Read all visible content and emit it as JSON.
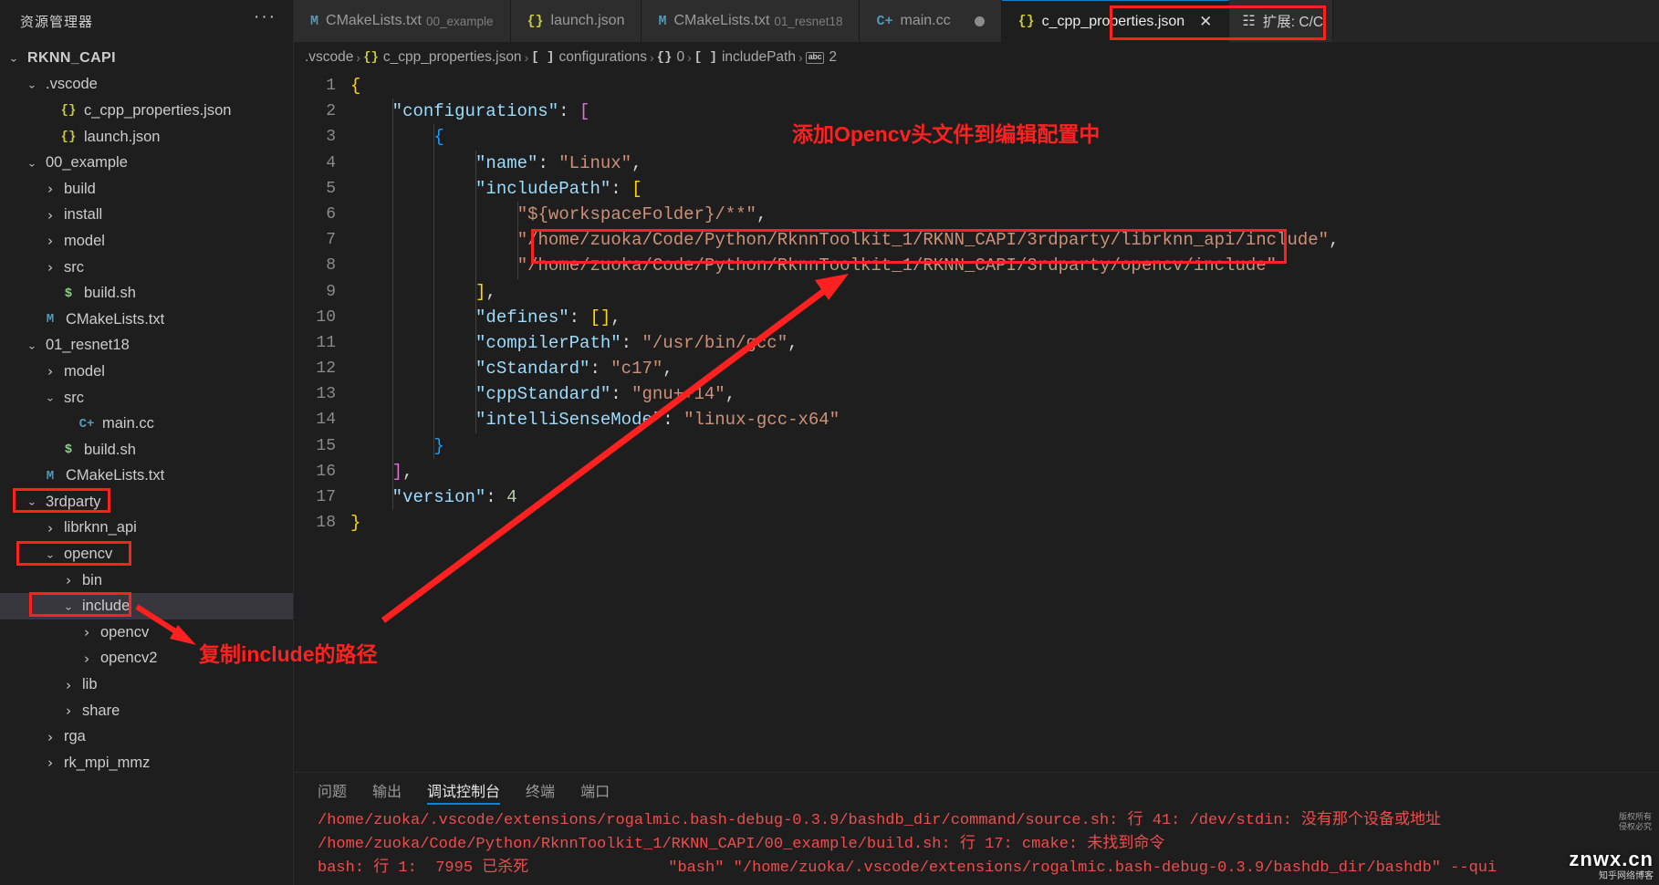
{
  "sidebar": {
    "title": "资源管理器",
    "more_icon": "ellipsis-icon",
    "root": "RKNN_CAPI",
    "items": [
      {
        "label": ".vscode",
        "indent": 1,
        "chev": "down",
        "icon": ""
      },
      {
        "label": "c_cpp_properties.json",
        "indent": 2,
        "chev": "",
        "icon": "{}"
      },
      {
        "label": "launch.json",
        "indent": 2,
        "chev": "",
        "icon": "{}"
      },
      {
        "label": "00_example",
        "indent": 1,
        "chev": "down",
        "icon": ""
      },
      {
        "label": "build",
        "indent": 2,
        "chev": "right",
        "icon": ""
      },
      {
        "label": "install",
        "indent": 2,
        "chev": "right",
        "icon": ""
      },
      {
        "label": "model",
        "indent": 2,
        "chev": "right",
        "icon": ""
      },
      {
        "label": "src",
        "indent": 2,
        "chev": "right",
        "icon": ""
      },
      {
        "label": "build.sh",
        "indent": 2,
        "chev": "",
        "icon": "$"
      },
      {
        "label": "CMakeLists.txt",
        "indent": 1,
        "chev": "",
        "icon": "M"
      },
      {
        "label": "01_resnet18",
        "indent": 1,
        "chev": "down",
        "icon": ""
      },
      {
        "label": "model",
        "indent": 2,
        "chev": "right",
        "icon": ""
      },
      {
        "label": "src",
        "indent": 2,
        "chev": "down",
        "icon": ""
      },
      {
        "label": "main.cc",
        "indent": 3,
        "chev": "",
        "icon": "C+"
      },
      {
        "label": "build.sh",
        "indent": 2,
        "chev": "",
        "icon": "$"
      },
      {
        "label": "CMakeLists.txt",
        "indent": 1,
        "chev": "",
        "icon": "M"
      },
      {
        "label": "3rdparty",
        "indent": 1,
        "chev": "down",
        "icon": ""
      },
      {
        "label": "librknn_api",
        "indent": 2,
        "chev": "right",
        "icon": ""
      },
      {
        "label": "opencv",
        "indent": 2,
        "chev": "down",
        "icon": ""
      },
      {
        "label": "bin",
        "indent": 3,
        "chev": "right",
        "icon": ""
      },
      {
        "label": "include",
        "indent": 3,
        "chev": "down",
        "icon": "",
        "selected": true
      },
      {
        "label": "opencv",
        "indent": 4,
        "chev": "right",
        "icon": ""
      },
      {
        "label": "opencv2",
        "indent": 4,
        "chev": "right",
        "icon": ""
      },
      {
        "label": "lib",
        "indent": 3,
        "chev": "right",
        "icon": ""
      },
      {
        "label": "share",
        "indent": 3,
        "chev": "right",
        "icon": ""
      },
      {
        "label": "rga",
        "indent": 2,
        "chev": "right",
        "icon": ""
      },
      {
        "label": "rk_mpi_mmz",
        "indent": 2,
        "chev": "right",
        "icon": ""
      }
    ]
  },
  "tabs": [
    {
      "icon": "M",
      "icon_kind": "m",
      "label": "CMakeLists.txt",
      "sub": "00_example",
      "active": false,
      "dirty": false,
      "close": false
    },
    {
      "icon": "{}",
      "icon_kind": "j",
      "label": "launch.json",
      "sub": "",
      "active": false,
      "dirty": false,
      "close": false
    },
    {
      "icon": "M",
      "icon_kind": "m",
      "label": "CMakeLists.txt",
      "sub": "01_resnet18",
      "active": false,
      "dirty": false,
      "close": false
    },
    {
      "icon": "C+",
      "icon_kind": "c",
      "label": "main.cc",
      "sub": "",
      "active": false,
      "dirty": true,
      "close": false
    },
    {
      "icon": "{}",
      "icon_kind": "j",
      "label": "c_cpp_properties.json",
      "sub": "",
      "active": true,
      "dirty": false,
      "close": true
    }
  ],
  "tab_extension": {
    "icon": "extensions-icon",
    "label": "扩展: C/C"
  },
  "breadcrumb": [
    {
      "icon": "",
      "kind": "",
      "label": ".vscode"
    },
    {
      "icon": "{}",
      "kind": "json",
      "label": "c_cpp_properties.json"
    },
    {
      "icon": "[ ]",
      "kind": "arr",
      "label": "configurations"
    },
    {
      "icon": "{}",
      "kind": "obj",
      "label": "0"
    },
    {
      "icon": "[ ]",
      "kind": "arr",
      "label": "includePath"
    },
    {
      "icon": "abc",
      "kind": "abc",
      "label": "2"
    }
  ],
  "code": {
    "lines": [
      {
        "n": 1,
        "tokens": [
          {
            "t": "{",
            "c": "b1"
          }
        ],
        "indent": 0
      },
      {
        "n": 2,
        "tokens": [
          {
            "t": "\"configurations\"",
            "c": "k"
          },
          {
            "t": ": ",
            "c": "p"
          },
          {
            "t": "[",
            "c": "b2"
          }
        ],
        "indent": 1
      },
      {
        "n": 3,
        "tokens": [
          {
            "t": "{",
            "c": "b3"
          }
        ],
        "indent": 2
      },
      {
        "n": 4,
        "tokens": [
          {
            "t": "\"name\"",
            "c": "k"
          },
          {
            "t": ": ",
            "c": "p"
          },
          {
            "t": "\"Linux\"",
            "c": "s"
          },
          {
            "t": ",",
            "c": "p"
          }
        ],
        "indent": 3
      },
      {
        "n": 5,
        "tokens": [
          {
            "t": "\"includePath\"",
            "c": "k"
          },
          {
            "t": ": ",
            "c": "p"
          },
          {
            "t": "[",
            "c": "b1"
          }
        ],
        "indent": 3
      },
      {
        "n": 6,
        "tokens": [
          {
            "t": "\"${workspaceFolder}/**\"",
            "c": "s"
          },
          {
            "t": ",",
            "c": "p"
          }
        ],
        "indent": 4
      },
      {
        "n": 7,
        "tokens": [
          {
            "t": "\"/home/zuoka/Code/Python/RknnToolkit_1/RKNN_CAPI/3rdparty/librknn_api/include\"",
            "c": "s"
          },
          {
            "t": ",",
            "c": "p"
          }
        ],
        "indent": 4
      },
      {
        "n": 8,
        "tokens": [
          {
            "t": "\"/home/zuoka/Code/Python/RknnToolkit_1/RKNN_CAPI/3rdparty/opencv/include\"",
            "c": "s"
          }
        ],
        "indent": 4
      },
      {
        "n": 9,
        "tokens": [
          {
            "t": "]",
            "c": "b1"
          },
          {
            "t": ",",
            "c": "p"
          }
        ],
        "indent": 3
      },
      {
        "n": 10,
        "tokens": [
          {
            "t": "\"defines\"",
            "c": "k"
          },
          {
            "t": ": ",
            "c": "p"
          },
          {
            "t": "[]",
            "c": "b1"
          },
          {
            "t": ",",
            "c": "p"
          }
        ],
        "indent": 3
      },
      {
        "n": 11,
        "tokens": [
          {
            "t": "\"compilerPath\"",
            "c": "k"
          },
          {
            "t": ": ",
            "c": "p"
          },
          {
            "t": "\"/usr/bin/gcc\"",
            "c": "s"
          },
          {
            "t": ",",
            "c": "p"
          }
        ],
        "indent": 3
      },
      {
        "n": 12,
        "tokens": [
          {
            "t": "\"cStandard\"",
            "c": "k"
          },
          {
            "t": ": ",
            "c": "p"
          },
          {
            "t": "\"c17\"",
            "c": "s"
          },
          {
            "t": ",",
            "c": "p"
          }
        ],
        "indent": 3
      },
      {
        "n": 13,
        "tokens": [
          {
            "t": "\"cppStandard\"",
            "c": "k"
          },
          {
            "t": ": ",
            "c": "p"
          },
          {
            "t": "\"gnu++14\"",
            "c": "s"
          },
          {
            "t": ",",
            "c": "p"
          }
        ],
        "indent": 3
      },
      {
        "n": 14,
        "tokens": [
          {
            "t": "\"intelliSenseMode\"",
            "c": "k"
          },
          {
            "t": ": ",
            "c": "p"
          },
          {
            "t": "\"linux-gcc-x64\"",
            "c": "s"
          }
        ],
        "indent": 3
      },
      {
        "n": 15,
        "tokens": [
          {
            "t": "}",
            "c": "b3"
          }
        ],
        "indent": 2
      },
      {
        "n": 16,
        "tokens": [
          {
            "t": "]",
            "c": "b2"
          },
          {
            "t": ",",
            "c": "p"
          }
        ],
        "indent": 1
      },
      {
        "n": 17,
        "tokens": [
          {
            "t": "\"version\"",
            "c": "k"
          },
          {
            "t": ": ",
            "c": "p"
          },
          {
            "t": "4",
            "c": "num"
          }
        ],
        "indent": 1
      },
      {
        "n": 18,
        "tokens": [
          {
            "t": "}",
            "c": "b1"
          }
        ],
        "indent": 0
      }
    ]
  },
  "panel": {
    "tabs": [
      {
        "label": "问题",
        "active": false
      },
      {
        "label": "输出",
        "active": false
      },
      {
        "label": "调试控制台",
        "active": true
      },
      {
        "label": "终端",
        "active": false
      },
      {
        "label": "端口",
        "active": false
      }
    ],
    "output": [
      "/home/zuoka/.vscode/extensions/rogalmic.bash-debug-0.3.9/bashdb_dir/command/source.sh: 行 41: /dev/stdin: 没有那个设备或地址",
      "/home/zuoka/Code/Python/RknnToolkit_1/RKNN_CAPI/00_example/build.sh: 行 17: cmake: 未找到命令",
      "bash: 行 1:  7995 已杀死               \"bash\" \"/home/zuoka/.vscode/extensions/rogalmic.bash-debug-0.3.9/bashdb_dir/bashdb\" --qui"
    ]
  },
  "annotations": {
    "note_header": "添加Opencv头文件到编辑配置中",
    "note_copy": "复制include的路径"
  },
  "watermark": {
    "main": "znwx.cn",
    "sub": "知乎网络博客",
    "tiny": "版权所有\n侵权必究"
  },
  "colors": {
    "accent": "#0a84d1",
    "annotation": "#ff2020",
    "selected_row": "#37373d",
    "editor_bg": "#1e1e1e",
    "tabbar_bg": "#252526"
  }
}
